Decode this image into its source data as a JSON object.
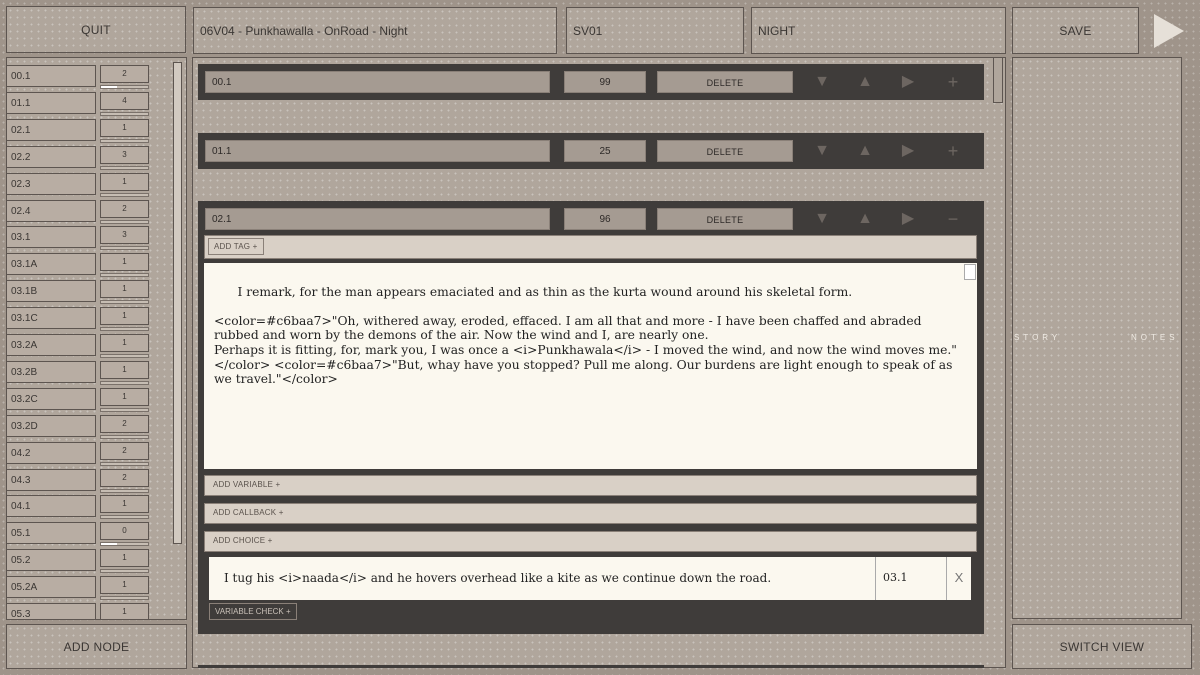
{
  "toolbar": {
    "quit_label": "QUIT",
    "scene_title": "06V04 - Punkhawalla - OnRoad - Night",
    "scene_code": "SV01",
    "time_of_day": "NIGHT",
    "save_label": "SAVE",
    "play_icon": "play-triangle-icon"
  },
  "sidebar": {
    "nodes": [
      {
        "name": "00.1",
        "count": "2",
        "progress": 0.35
      },
      {
        "name": "01.1",
        "count": "4",
        "progress": 0
      },
      {
        "name": "02.1",
        "count": "1",
        "progress": 0
      },
      {
        "name": "02.2",
        "count": "3",
        "progress": 0
      },
      {
        "name": "02.3",
        "count": "1",
        "progress": 0
      },
      {
        "name": "02.4",
        "count": "2",
        "progress": 0
      },
      {
        "name": "03.1",
        "count": "3",
        "progress": 0
      },
      {
        "name": "03.1A",
        "count": "1",
        "progress": 0
      },
      {
        "name": "03.1B",
        "count": "1",
        "progress": 0
      },
      {
        "name": "03.1C",
        "count": "1",
        "progress": 0
      },
      {
        "name": "03.2A",
        "count": "1",
        "progress": 0
      },
      {
        "name": "03.2B",
        "count": "1",
        "progress": 0
      },
      {
        "name": "03.2C",
        "count": "1",
        "progress": 0
      },
      {
        "name": "03.2D",
        "count": "2",
        "progress": 0
      },
      {
        "name": "04.2",
        "count": "2",
        "progress": 0
      },
      {
        "name": "04.3",
        "count": "2",
        "progress": 0
      },
      {
        "name": "04.1",
        "count": "1",
        "progress": 0
      },
      {
        "name": "05.1",
        "count": "0",
        "progress": 0.35
      },
      {
        "name": "05.2",
        "count": "1",
        "progress": 0
      },
      {
        "name": "05.2A",
        "count": "1",
        "progress": 0
      },
      {
        "name": "05.3",
        "count": "1",
        "progress": 0
      }
    ],
    "add_node_label": "ADD NODE"
  },
  "blocks": [
    {
      "id": "00.1",
      "number": "99",
      "delete_label": "DELETE",
      "toggle": "+"
    },
    {
      "id": "01.1",
      "number": "25",
      "delete_label": "DELETE",
      "toggle": "+"
    },
    {
      "id": "02.1",
      "number": "96",
      "delete_label": "DELETE",
      "toggle": "−"
    }
  ],
  "expanded": {
    "add_tag_label": "ADD TAG +",
    "text": "I remark, for the man appears emaciated and as thin as the kurta wound around his skeletal form.\n\n<color=#c6baa7>\"Oh, withered away, eroded, effaced. I am all that and more - I have been chaffed and abraded rubbed and worn by the demons of the air. Now the wind and I, are nearly one.\nPerhaps it is fitting, for, mark you, I was once a <i>Punkhawala</i> - I moved the wind, and now the wind moves me.\" </color> <color=#c6baa7>\"But, whay have you stopped? Pull me along. Our burdens are light enough to speak of as we travel.\"</color>",
    "add_variable_label": "ADD VARIABLE +",
    "add_callback_label": "ADD CALLBACK +",
    "add_choice_label": "ADD CHOICE +",
    "choice": {
      "text": "I tug his <i>naada</i> and he hovers overhead like a kite as we continue down the road.",
      "target": "03.1",
      "remove": "X"
    },
    "variable_check_label": "VARIABLE CHECK +"
  },
  "right_panel": {
    "story_label": "STORY",
    "notes_label": "NOTES",
    "switch_view_label": "SWITCH VIEW"
  }
}
